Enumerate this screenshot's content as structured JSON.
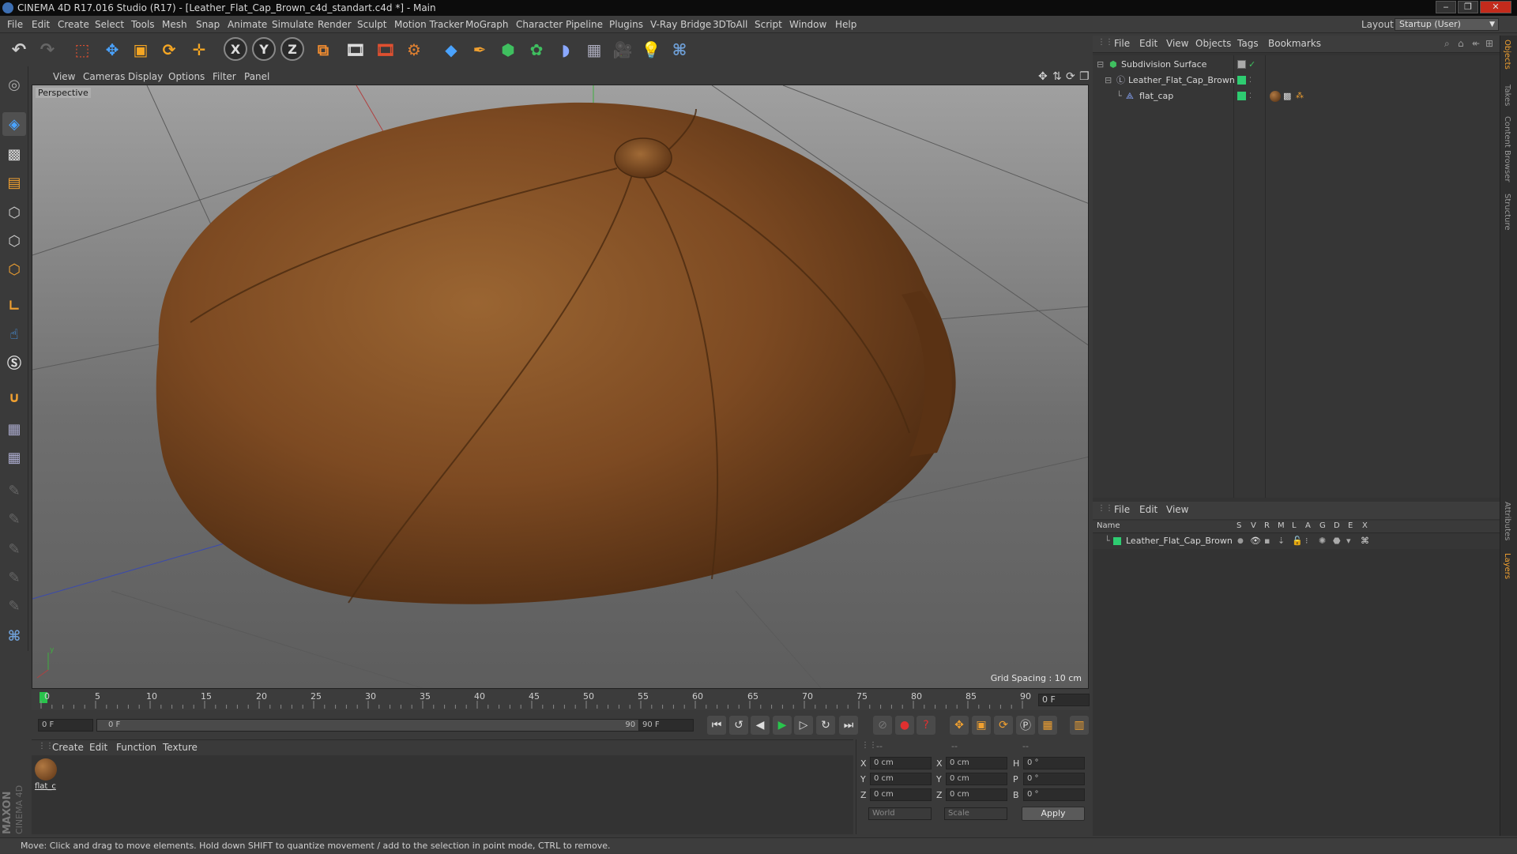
{
  "window": {
    "title": "CINEMA 4D R17.016 Studio (R17) - [Leather_Flat_Cap_Brown_c4d_standart.c4d *] - Main",
    "minimize": "‒",
    "maximize": "❐",
    "close": "✕"
  },
  "menubar": {
    "items": [
      "File",
      "Edit",
      "Create",
      "Select",
      "Tools",
      "Mesh",
      "Snap",
      "Animate",
      "Simulate",
      "Render",
      "Sculpt",
      "Motion Tracker",
      "MoGraph",
      "Character",
      "Pipeline",
      "Plugins",
      "V-Ray Bridge",
      "3DToAll",
      "Script",
      "Window",
      "Help"
    ],
    "layout_label": "Layout:",
    "layout_value": "Startup (User)"
  },
  "toolbar": {
    "axis_x": "X",
    "axis_y": "Y",
    "axis_z": "Z"
  },
  "viewport": {
    "menu": [
      "View",
      "Cameras",
      "Display",
      "Options",
      "Filter",
      "Panel"
    ],
    "label": "Perspective",
    "grid_spacing": "Grid Spacing : 10 cm"
  },
  "timeline": {
    "ticks": [
      "0",
      "5",
      "10",
      "15",
      "20",
      "25",
      "30",
      "35",
      "40",
      "45",
      "50",
      "55",
      "60",
      "65",
      "70",
      "75",
      "80",
      "85",
      "90"
    ],
    "current_frame": "0 F"
  },
  "transport": {
    "start": "0 F",
    "range_start": "0 F",
    "range_end": "90 F",
    "end": "90 F"
  },
  "material_manager": {
    "menu": [
      "Create",
      "Edit",
      "Function",
      "Texture"
    ],
    "material_name": "flat_c"
  },
  "coordinates": {
    "header": [
      "--",
      "--",
      "--"
    ],
    "rows": [
      {
        "a": "X",
        "av": "0 cm",
        "b": "X",
        "bv": "0 cm",
        "c": "H",
        "cv": "0 °"
      },
      {
        "a": "Y",
        "av": "0 cm",
        "b": "Y",
        "bv": "0 cm",
        "c": "P",
        "cv": "0 °"
      },
      {
        "a": "Z",
        "av": "0 cm",
        "b": "Z",
        "bv": "0 cm",
        "c": "B",
        "cv": "0 °"
      }
    ],
    "mode1": "World",
    "mode2": "Scale",
    "apply": "Apply"
  },
  "object_manager": {
    "menu": [
      "File",
      "Edit",
      "View",
      "Objects",
      "Tags",
      "Bookmarks"
    ],
    "objects": [
      {
        "name": "Subdivision Surface",
        "indent": 0
      },
      {
        "name": "Leather_Flat_Cap_Brown",
        "indent": 1
      },
      {
        "name": "flat_cap",
        "indent": 2
      }
    ]
  },
  "layer_manager": {
    "menu": [
      "File",
      "Edit",
      "View"
    ],
    "columns": [
      "Name",
      "S",
      "V",
      "R",
      "M",
      "L",
      "A",
      "G",
      "D",
      "E",
      "X"
    ],
    "layers": [
      "Leather_Flat_Cap_Brown"
    ]
  },
  "side_tabs": [
    "Objects",
    "Takes",
    "Content Browser",
    "Structure",
    "Attributes",
    "Layers"
  ],
  "status": "Move: Click and drag to move elements. Hold down SHIFT to quantize movement / add to the selection in point mode, CTRL to remove.",
  "maxon": {
    "line1": "MAXON",
    "line2": "CINEMA 4D"
  },
  "colors": {
    "accent": "#3d6fb3",
    "leather": "#8a5528",
    "layer_green": "#2ecc71"
  }
}
